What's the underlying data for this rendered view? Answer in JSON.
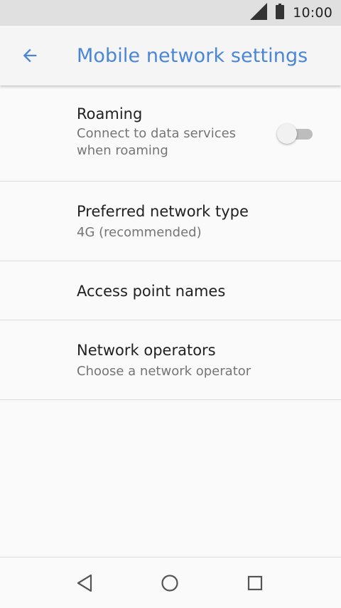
{
  "status_bar": {
    "time": "10:00",
    "icons": [
      "signal-icon",
      "battery-icon"
    ]
  },
  "app_bar": {
    "title": "Mobile network settings",
    "back_icon": "arrow-back-icon"
  },
  "settings": {
    "roaming": {
      "title": "Roaming",
      "summary": "Connect to data services when roaming",
      "enabled": false
    },
    "preferred_network": {
      "title": "Preferred network type",
      "summary": "4G (recommended)"
    },
    "apn": {
      "title": "Access point names"
    },
    "operators": {
      "title": "Network operators",
      "summary": "Choose a network operator"
    }
  },
  "nav_bar": {
    "icons": [
      "nav-back-icon",
      "nav-home-icon",
      "nav-recents-icon"
    ]
  },
  "colors": {
    "accent": "#4a86d8",
    "status_bar": "#e0e0e0",
    "background": "#fafafa"
  }
}
